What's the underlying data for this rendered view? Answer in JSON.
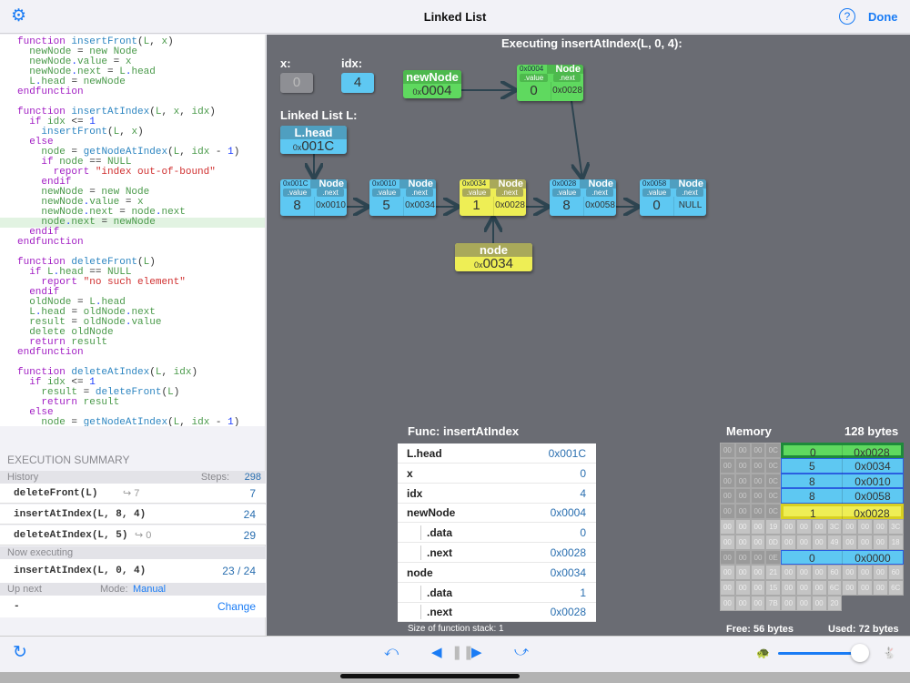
{
  "header": {
    "title": "Linked List",
    "settings_icon": "gear-icon",
    "help_icon": "question-circle-icon",
    "done_label": "Done"
  },
  "code": {
    "highlight_line": 19,
    "lines": [
      "function insertFront(L, x)",
      "  newNode = new Node",
      "  newNode.value = x",
      "  newNode.next = L.head",
      "  L.head = newNode",
      "endfunction",
      "",
      "function insertAtIndex(L, x, idx)",
      "  if idx <= 1",
      "    insertFront(L, x)",
      "  else",
      "    node = getNodeAtIndex(L, idx - 1)",
      "    if node == NULL",
      "      report \"index out-of-bound\"",
      "    endif",
      "    newNode = new Node",
      "    newNode.value = x",
      "    newNode.next = node.next",
      "    node.next = newNode",
      "  endif",
      "endfunction",
      "",
      "function deleteFront(L)",
      "  if L.head == NULL",
      "    report \"no such element\"",
      "  endif",
      "  oldNode = L.head",
      "  L.head = oldNode.next",
      "  result = oldNode.value",
      "  delete oldNode",
      "  return result",
      "endfunction",
      "",
      "function deleteAtIndex(L, idx)",
      "  if idx <= 1",
      "    result = deleteFront(L)",
      "    return result",
      "  else",
      "    node = getNodeAtIndex(L, idx - 1)"
    ]
  },
  "summary": {
    "title": "EXECUTION SUMMARY",
    "history_label": "History",
    "steps_label": "Steps:",
    "steps": "298",
    "history": [
      {
        "call": "deleteFront(L)",
        "ret": "↪ 7",
        "steps": "7"
      },
      {
        "call": "insertAtIndex(L, 8, 4)",
        "ret": "",
        "steps": "24"
      },
      {
        "call": "deleteAtIndex(L, 5)",
        "ret": "↪ 0",
        "steps": "29"
      }
    ],
    "now_label": "Now executing",
    "now": {
      "call": "insertAtIndex(L, 0, 4)",
      "steps": "23 / 24"
    },
    "next_label": "Up next",
    "mode_label": "Mode:",
    "mode": "Manual",
    "next_value": "-",
    "change_label": "Change"
  },
  "diagram": {
    "title": "Executing insertAtIndex(L, 0, 4):",
    "x": {
      "label": "x:",
      "value": "0"
    },
    "idx": {
      "label": "idx:",
      "value": "4"
    },
    "newNode": {
      "label": "newNode",
      "prefix": "0x",
      "value": "0004"
    },
    "list_label": "Linked List L:",
    "head": {
      "label": "L.head",
      "prefix": "0x",
      "value": "001C"
    },
    "nodevar": {
      "label": "node",
      "prefix": "0x",
      "value": "0034"
    },
    "node_label": "Node",
    "value_label": ".value",
    "next_label": ".next",
    "new_node": {
      "addr": "0x0004",
      "value": "0",
      "next": "0x0028"
    },
    "nodes": [
      {
        "addr": "0x001C",
        "value": "8",
        "next": "0x0010",
        "color": "blue"
      },
      {
        "addr": "0x0010",
        "value": "5",
        "next": "0x0034",
        "color": "blue"
      },
      {
        "addr": "0x0034",
        "value": "1",
        "next": "0x0028",
        "color": "yellow"
      },
      {
        "addr": "0x0028",
        "value": "8",
        "next": "0x0058",
        "color": "blue"
      },
      {
        "addr": "0x0058",
        "value": "0",
        "next": "NULL",
        "color": "blue"
      }
    ],
    "colors": {
      "blue": "#5ec8f2",
      "green": "#5fd95f",
      "yellow": "#eeee55",
      "bg": "#6a6c73"
    }
  },
  "func": {
    "title": "Func: insertAtIndex",
    "rows": [
      {
        "k": "L.head",
        "v": "0x001C"
      },
      {
        "k": "x",
        "v": "0"
      },
      {
        "k": "idx",
        "v": "4"
      },
      {
        "k": "newNode",
        "v": "0x0004"
      },
      {
        "k": ".data",
        "v": "0",
        "sub": true
      },
      {
        "k": ".next",
        "v": "0x0028",
        "sub": true
      },
      {
        "k": "node",
        "v": "0x0034"
      },
      {
        "k": ".data",
        "v": "1",
        "sub": true
      },
      {
        "k": ".next",
        "v": "0x0028",
        "sub": true
      }
    ],
    "stack_size": "Size of function stack: 1"
  },
  "memory": {
    "title": "Memory",
    "size": "128 bytes",
    "free": "Free: 56 bytes",
    "used": "Used: 72 bytes",
    "rows": [
      {
        "cells": [
          "00",
          "00",
          "00",
          "0C"
        ],
        "block": {
          "value": "0",
          "next": "0x0028",
          "color": "green"
        }
      },
      {
        "cells": [
          "00",
          "00",
          "00",
          "0C"
        ],
        "block": {
          "value": "5",
          "next": "0x0034",
          "color": "blue"
        }
      },
      {
        "cells": [
          "00",
          "00",
          "00",
          "0C"
        ],
        "block": {
          "value": "8",
          "next": "0x0010",
          "color": "blue"
        }
      },
      {
        "cells": [
          "00",
          "00",
          "00",
          "0C"
        ],
        "block": {
          "value": "8",
          "next": "0x0058",
          "color": "blue"
        }
      },
      {
        "cells": [
          "00",
          "00",
          "00",
          "0C"
        ],
        "block": {
          "value": "1",
          "next": "0x0028",
          "color": "yellow"
        }
      },
      {
        "cells": [
          "00",
          "00",
          "00",
          "19",
          "00",
          "00",
          "00",
          "3C",
          "00",
          "00",
          "00",
          "3C"
        ]
      },
      {
        "cells": [
          "00",
          "00",
          "00",
          "0D",
          "00",
          "00",
          "00",
          "49",
          "00",
          "00",
          "00",
          "18"
        ]
      },
      {
        "cells": [
          "00",
          "00",
          "00",
          "0E"
        ],
        "block": {
          "value": "0",
          "next": "0x0000",
          "color": "blue"
        }
      },
      {
        "cells": [
          "00",
          "00",
          "00",
          "21",
          "00",
          "00",
          "00",
          "60",
          "00",
          "00",
          "00",
          "60"
        ]
      },
      {
        "cells": [
          "00",
          "00",
          "00",
          "15",
          "00",
          "00",
          "00",
          "6C",
          "00",
          "00",
          "00",
          "6C"
        ]
      },
      {
        "cells": [
          "00",
          "00",
          "00",
          "7B",
          "00",
          "00",
          "00",
          "20"
        ]
      }
    ]
  },
  "toolbar": {
    "reset_icon": "refresh-icon",
    "step_back_icon": "step-back-icon",
    "prev_icon": "prev-icon",
    "pause_icon": "pause-icon",
    "next_icon": "next-icon",
    "step_over_icon": "step-over-icon",
    "slow_icon": "turtle-icon",
    "fast_icon": "rabbit-icon",
    "speed": 0.95
  }
}
